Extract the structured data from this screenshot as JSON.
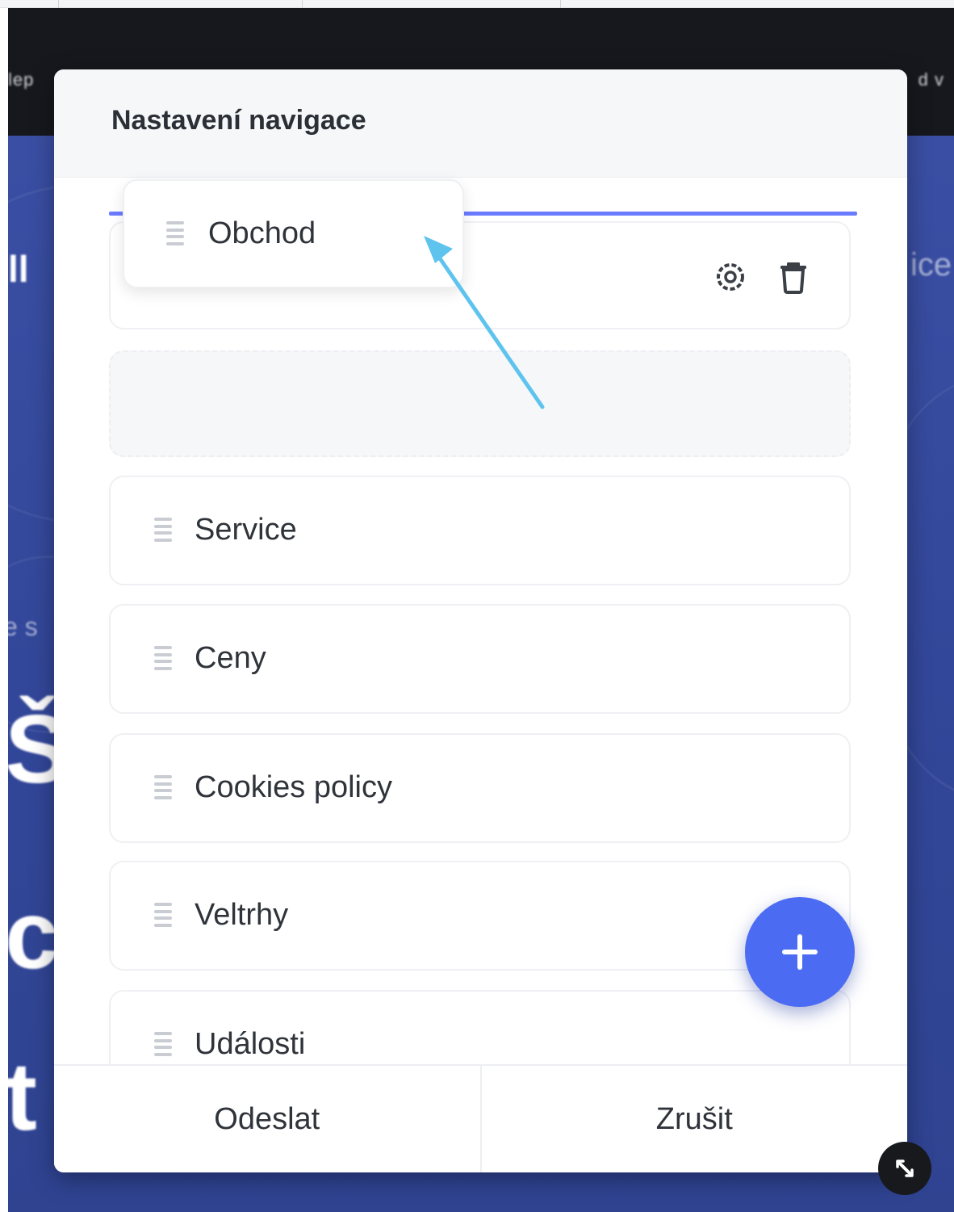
{
  "modal": {
    "title": "Nastavení navigace",
    "dragged_item": {
      "label": "Obchod",
      "icon": "drag-handle-icon"
    },
    "dragged_card_actions": [
      "settings-icon",
      "trash-icon"
    ],
    "items": [
      {
        "label": "Service",
        "icon": "drag-handle-icon"
      },
      {
        "label": "Ceny",
        "icon": "drag-handle-icon"
      },
      {
        "label": "Cookies policy",
        "icon": "drag-handle-icon"
      },
      {
        "label": "Veltrhy",
        "icon": "drag-handle-icon"
      },
      {
        "label": "Události",
        "icon": "drag-handle-icon"
      }
    ],
    "add_button_icon": "plus-icon",
    "footer": {
      "submit_label": "Odeslat",
      "cancel_label": "Zrušit"
    },
    "resize_icon": "resize-icon"
  },
  "colors": {
    "accent": "#4b6bf2",
    "drop_indicator": "#6a7bff",
    "drag_arrow": "#5ec4ee",
    "page_background": "#33479a",
    "top_bar": "#16181d"
  }
}
